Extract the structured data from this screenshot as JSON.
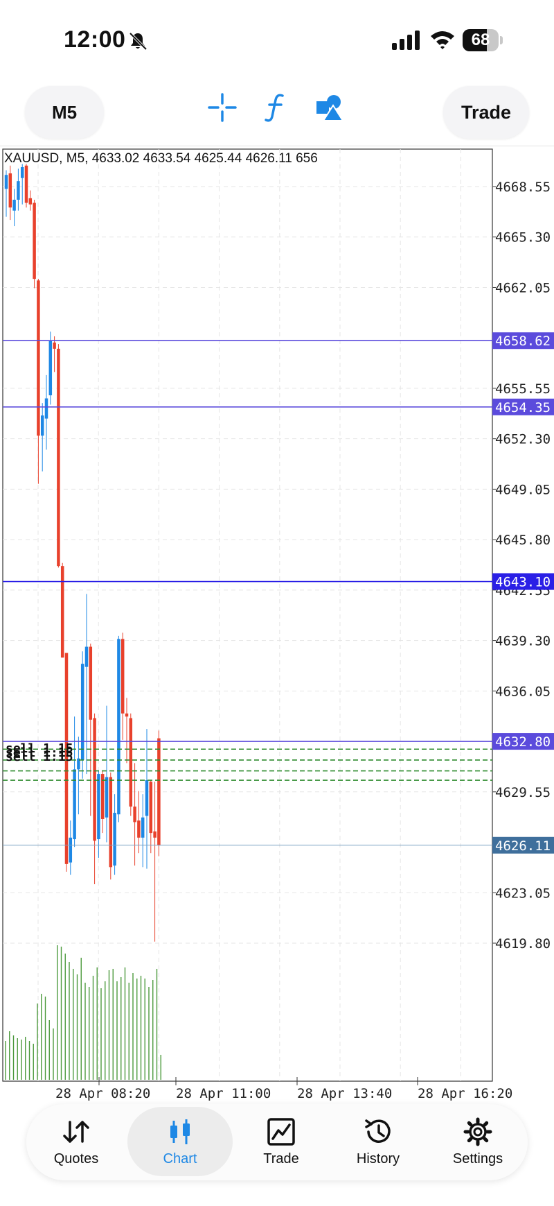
{
  "status_bar": {
    "time": "12:00",
    "battery_percent": 68,
    "battery_label": "68"
  },
  "toolbar": {
    "timeframe": "M5",
    "trade_label": "Trade",
    "icons": [
      "crosshair-icon",
      "function-icon",
      "objects-icon"
    ],
    "accent_color": "#1e88e5"
  },
  "chart": {
    "info_line": "XAUUSD, M5, 4633.02 4633.54 4625.44 4626.11 656",
    "symbol": "XAUUSD",
    "timeframe": "M5",
    "open": 4633.02,
    "high": 4633.54,
    "low": 4625.44,
    "close": 4626.11,
    "volume": 656,
    "price_ticks": [
      "4668.55",
      "4665.30",
      "4662.05",
      "4655.55",
      "4652.30",
      "4649.05",
      "4645.80",
      "4642.55",
      "4639.30",
      "4636.05",
      "4629.55",
      "4623.05",
      "4619.80"
    ],
    "time_labels": [
      "28 Apr 08:20",
      "28 Apr 11:00",
      "28 Apr 13:40",
      "28 Apr 16:20"
    ],
    "level_lines": [
      {
        "price": 4658.62,
        "label": "4658.62",
        "color": "#5b4bdc"
      },
      {
        "price": 4654.35,
        "label": "4654.35",
        "color": "#5b4bdc"
      },
      {
        "price": 4643.1,
        "label": "4643.10",
        "color": "#2a1fe6"
      },
      {
        "price": 4632.8,
        "label": "4632.80",
        "color": "#5b4bdc"
      }
    ],
    "current_price": {
      "price": 4626.11,
      "label": "4626.11",
      "color": "#3f6f9c"
    },
    "order_label": "sell 1.15",
    "order_lines": [
      4632.3,
      4631.6,
      4630.9,
      4630.3
    ],
    "up_color": "#1e88e5",
    "down_color": "#e8412c",
    "volume_color": "#4c9a3c",
    "candles": [
      {
        "o": 4668.4,
        "h": 4669.6,
        "l": 4666.6,
        "c": 4669.3
      },
      {
        "o": 4669.4,
        "h": 4669.9,
        "l": 4666.4,
        "c": 4667.2
      },
      {
        "o": 4667.0,
        "h": 4668.4,
        "l": 4666.0,
        "c": 4667.7
      },
      {
        "o": 4667.7,
        "h": 4669.7,
        "l": 4667.0,
        "c": 4668.9
      },
      {
        "o": 4669.1,
        "h": 4670.0,
        "l": 4667.4,
        "c": 4669.8
      },
      {
        "o": 4669.9,
        "h": 4670.0,
        "l": 4667.2,
        "c": 4667.5
      },
      {
        "o": 4667.8,
        "h": 4668.3,
        "l": 4667.0,
        "c": 4667.4
      },
      {
        "o": 4667.5,
        "h": 4667.7,
        "l": 4662.0,
        "c": 4662.6
      },
      {
        "o": 4662.5,
        "h": 4662.6,
        "l": 4649.4,
        "c": 4652.5
      },
      {
        "o": 4652.5,
        "h": 4654.6,
        "l": 4650.2,
        "c": 4653.8
      },
      {
        "o": 4653.6,
        "h": 4656.4,
        "l": 4651.6,
        "c": 4654.9
      },
      {
        "o": 4655.1,
        "h": 4659.2,
        "l": 4654.5,
        "c": 4658.6
      },
      {
        "o": 4658.5,
        "h": 4658.9,
        "l": 4656.6,
        "c": 4658.1
      },
      {
        "o": 4658.1,
        "h": 4658.4,
        "l": 4644.0,
        "c": 4644.1
      },
      {
        "o": 4644.1,
        "h": 4644.3,
        "l": 4639.5,
        "c": 4638.2
      },
      {
        "o": 4638.5,
        "h": 4637.3,
        "l": 4624.4,
        "c": 4624.9
      },
      {
        "o": 4625.0,
        "h": 4627.7,
        "l": 4624.2,
        "c": 4626.6
      },
      {
        "o": 4626.5,
        "h": 4634.4,
        "l": 4626.0,
        "c": 4631.0
      },
      {
        "o": 4631.0,
        "h": 4633.1,
        "l": 4628.1,
        "c": 4631.7
      },
      {
        "o": 4631.6,
        "h": 4638.6,
        "l": 4630.4,
        "c": 4637.8
      },
      {
        "o": 4637.6,
        "h": 4642.3,
        "l": 4630.7,
        "c": 4638.9
      },
      {
        "o": 4638.9,
        "h": 4639.1,
        "l": 4628.0,
        "c": 4634.2
      },
      {
        "o": 4634.3,
        "h": 4634.6,
        "l": 4623.6,
        "c": 4626.4
      },
      {
        "o": 4626.5,
        "h": 4630.9,
        "l": 4625.3,
        "c": 4630.7
      },
      {
        "o": 4630.7,
        "h": 4630.9,
        "l": 4626.9,
        "c": 4627.8
      },
      {
        "o": 4627.9,
        "h": 4635.1,
        "l": 4626.3,
        "c": 4630.5
      },
      {
        "o": 4630.5,
        "h": 4630.8,
        "l": 4623.9,
        "c": 4624.7
      },
      {
        "o": 4624.8,
        "h": 4629.4,
        "l": 4624.2,
        "c": 4628.2
      },
      {
        "o": 4628.1,
        "h": 4639.6,
        "l": 4627.6,
        "c": 4639.4
      },
      {
        "o": 4639.4,
        "h": 4639.8,
        "l": 4632.9,
        "c": 4634.6
      },
      {
        "o": 4634.6,
        "h": 4635.6,
        "l": 4631.4,
        "c": 4634.4
      },
      {
        "o": 4634.3,
        "h": 4634.6,
        "l": 4628.0,
        "c": 4628.6
      },
      {
        "o": 4628.6,
        "h": 4631.4,
        "l": 4624.8,
        "c": 4627.6
      },
      {
        "o": 4627.7,
        "h": 4629.6,
        "l": 4625.6,
        "c": 4626.6
      },
      {
        "o": 4626.6,
        "h": 4629.4,
        "l": 4624.7,
        "c": 4627.9
      },
      {
        "o": 4628.0,
        "h": 4633.6,
        "l": 4624.6,
        "c": 4630.3
      },
      {
        "o": 4630.2,
        "h": 4630.3,
        "l": 4625.6,
        "c": 4626.9
      },
      {
        "o": 4627.0,
        "h": 4630.2,
        "l": 4619.9,
        "c": 4626.6
      },
      {
        "o": 4633.0,
        "h": 4633.5,
        "l": 4625.4,
        "c": 4626.1
      }
    ],
    "volumes": [
      0.28,
      0.35,
      0.32,
      0.3,
      0.29,
      0.31,
      0.28,
      0.26,
      0.55,
      0.62,
      0.6,
      0.43,
      0.37,
      0.97,
      0.96,
      0.91,
      0.85,
      0.8,
      0.76,
      0.88,
      0.7,
      0.67,
      0.75,
      0.81,
      0.66,
      0.71,
      0.79,
      0.8,
      0.71,
      0.74,
      0.81,
      0.7,
      0.77,
      0.73,
      0.75,
      0.73,
      0.67,
      0.72,
      0.8,
      0.18
    ]
  },
  "bottom_nav": {
    "items": [
      {
        "label": "Quotes",
        "icon": "quotes-arrows-icon"
      },
      {
        "label": "Chart",
        "icon": "candlestick-icon",
        "active": true
      },
      {
        "label": "Trade",
        "icon": "trade-chart-icon"
      },
      {
        "label": "History",
        "icon": "history-clock-icon"
      },
      {
        "label": "Settings",
        "icon": "settings-gear-icon"
      }
    ]
  }
}
